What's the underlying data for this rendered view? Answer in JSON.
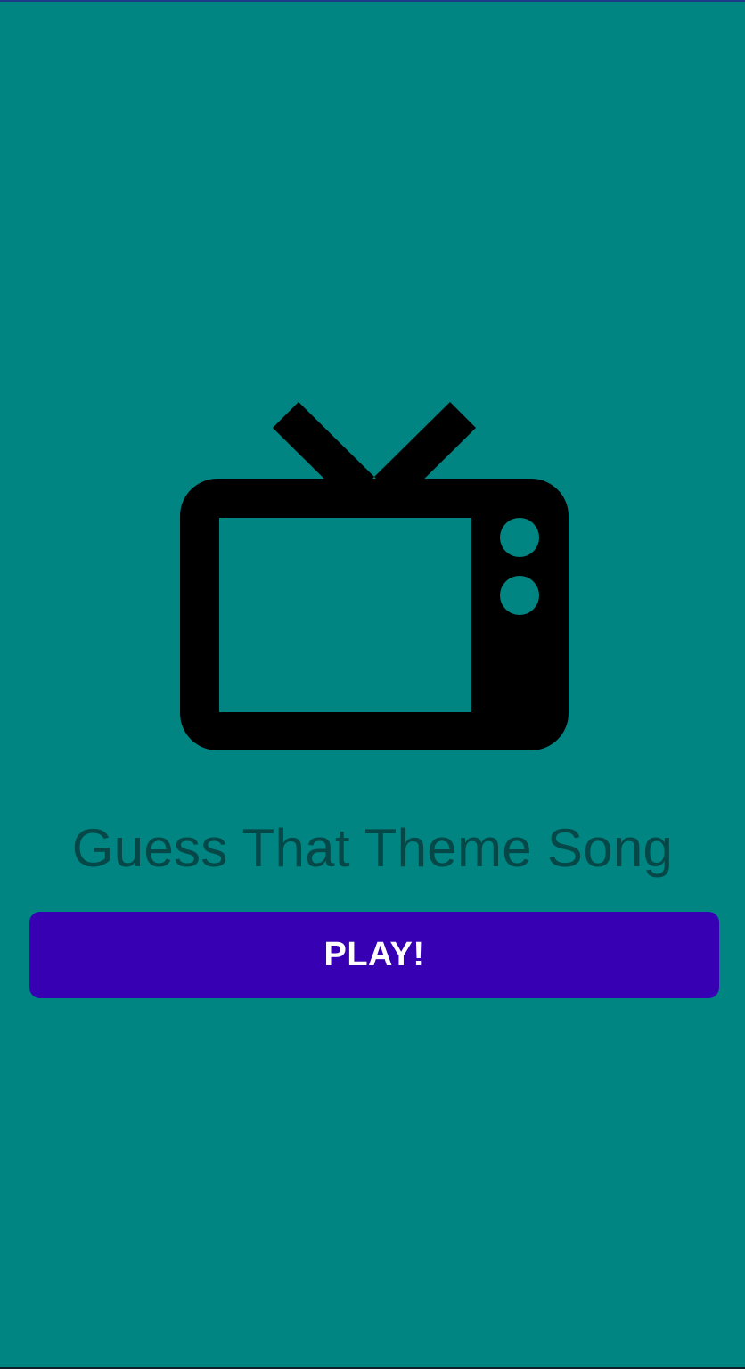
{
  "app": {
    "title": "Guess That Theme Song"
  },
  "icons": {
    "hero": "tv-icon"
  },
  "actions": {
    "play_label": "PLAY!"
  },
  "colors": {
    "background": "#008583",
    "title_text": "#064748",
    "button_background": "#3700b3",
    "button_text": "#ffffff",
    "icon": "#000000"
  }
}
